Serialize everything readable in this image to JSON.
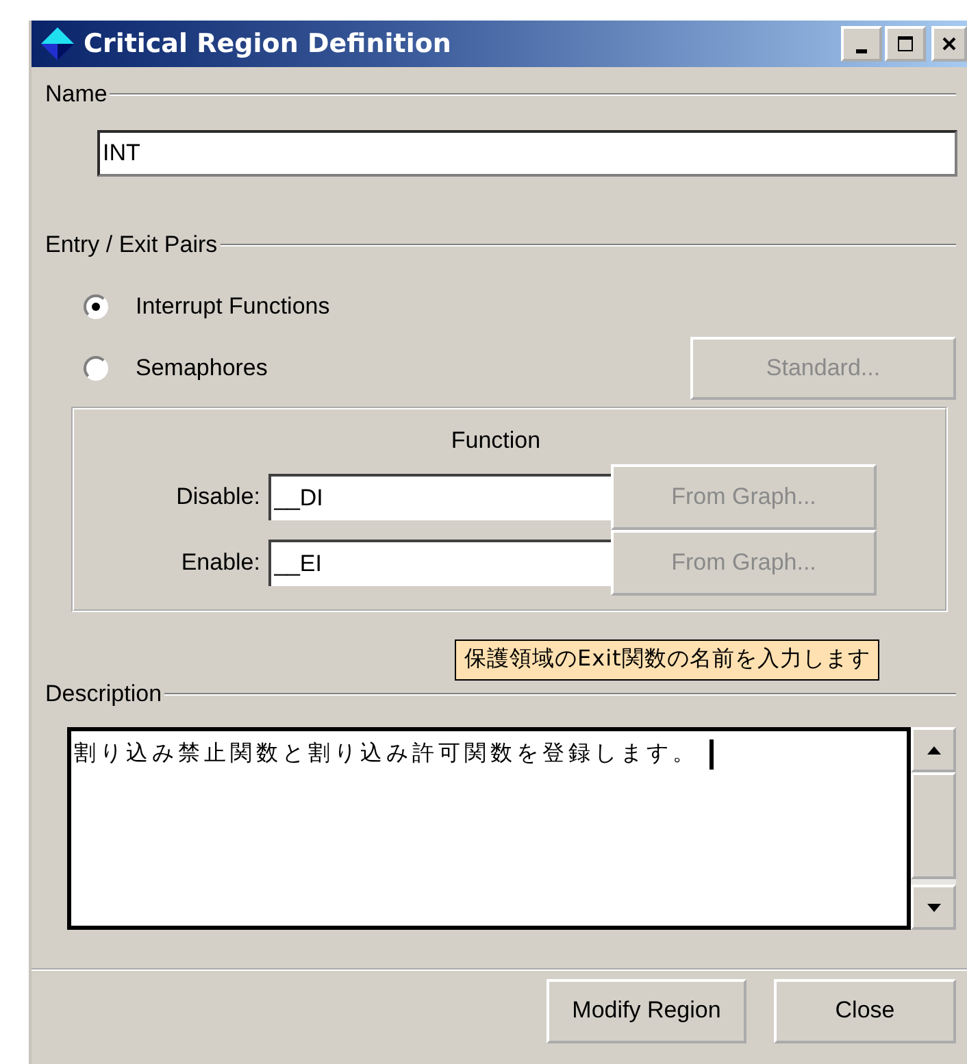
{
  "window": {
    "title": "Critical Region Definition"
  },
  "name_section": {
    "label": "Name",
    "value": "INT"
  },
  "entry_exit": {
    "label": "Entry / Exit Pairs",
    "options": [
      {
        "label": "Interrupt Functions",
        "selected": true
      },
      {
        "label": "Semaphores",
        "selected": false
      }
    ],
    "standard_button": {
      "label": "Standard...",
      "disabled": true
    },
    "function_group": {
      "title": "Function",
      "rows": [
        {
          "label": "Disable:",
          "value": "__DI",
          "button": "From Graph...",
          "disabled": true
        },
        {
          "label": "Enable:",
          "value": "__EI",
          "button": "From Graph...",
          "disabled": true
        }
      ]
    }
  },
  "tooltip": "保護領域のExit関数の名前を入力します",
  "description": {
    "label": "Description",
    "value": "割り込み禁止関数と割り込み許可関数を登録します。"
  },
  "buttons": [
    "Modify Region",
    "Close"
  ]
}
